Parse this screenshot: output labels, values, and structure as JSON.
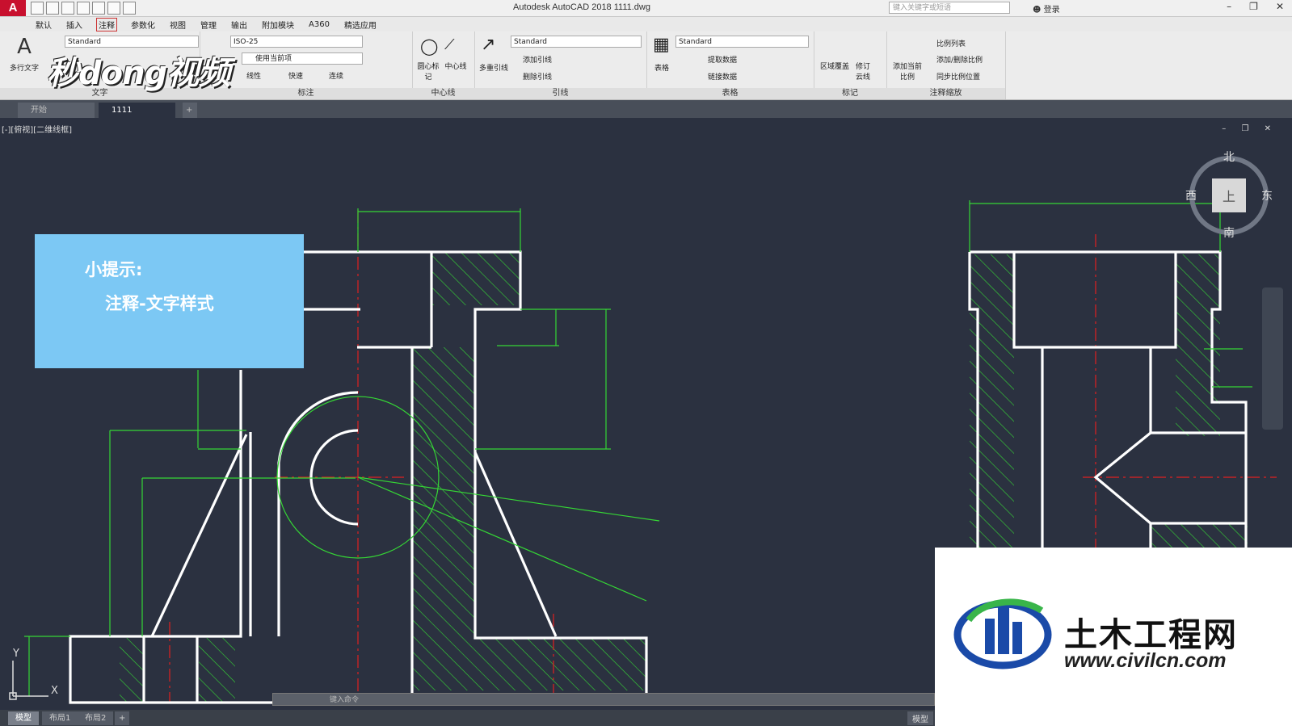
{
  "app": {
    "title": "Autodesk AutoCAD 2018    1111.dwg",
    "logo": "A",
    "search_placeholder": "键入关键字或短语",
    "login": "登录"
  },
  "menu": [
    "默认",
    "插入",
    "注释",
    "参数化",
    "视图",
    "管理",
    "输出",
    "附加模块",
    "A360",
    "精选应用"
  ],
  "ribbon": {
    "text_panel": {
      "big_label": "多行文字",
      "style": "Standard",
      "label": "文字"
    },
    "dim_panel": {
      "style": "ISO-25",
      "layer": "使用当前项",
      "linear": "线性",
      "quick": "快速",
      "continue": "连续",
      "label": "标注"
    },
    "center_panel": {
      "center_mark": "圆心标记",
      "centerline": "中心线",
      "label": "中心线"
    },
    "leader_panel": {
      "multileader": "多重引线",
      "style": "Standard",
      "add": "添加引线",
      "remove": "删除引线",
      "label": "引线"
    },
    "table_panel": {
      "table": "表格",
      "style": "Standard",
      "extract": "提取数据",
      "link": "链接数据",
      "label": "表格"
    },
    "markup_panel": {
      "wipeout": "区域覆盖",
      "revcloud": "修订云线",
      "label": "标记"
    },
    "scale_panel": {
      "add_scale": "添加当前比例",
      "scale_list": "比例列表",
      "add_delete": "添加/删除比例",
      "sync": "同步比例位置",
      "label": "注释缩放"
    }
  },
  "file_tabs": [
    "开始",
    "1111"
  ],
  "viewport": {
    "label": "[-][俯视][二维线框]",
    "compass": {
      "n": "北",
      "s": "南",
      "e": "东",
      "w": "西",
      "center": "上"
    },
    "ucs_x": "X",
    "ucs_y": "Y"
  },
  "hint": {
    "line1": "小提示:",
    "line2": "注释-文字样式"
  },
  "brand": "秒dong视频",
  "cmd_placeholder": "键入命令",
  "layout_tabs": [
    "模型",
    "布局1",
    "布局2"
  ],
  "status": {
    "model": "模型"
  },
  "watermark": {
    "title": "土木工程网",
    "url": "www.civilcn.com"
  }
}
